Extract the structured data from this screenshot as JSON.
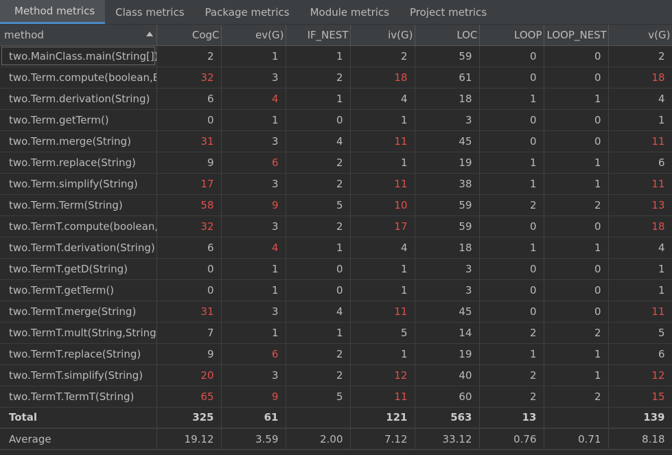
{
  "tabs": [
    {
      "label": "Method metrics",
      "active": true
    },
    {
      "label": "Class metrics",
      "active": false
    },
    {
      "label": "Package metrics",
      "active": false
    },
    {
      "label": "Module metrics",
      "active": false
    },
    {
      "label": "Project metrics",
      "active": false
    }
  ],
  "columns": [
    "method",
    "CogC",
    "ev(G)",
    "IF_NEST",
    "iv(G)",
    "LOC",
    "LOOP",
    "LOOP_NEST",
    "v(G)"
  ],
  "sort_column": "method",
  "sort_direction": "ascending",
  "highlight_color": "#e0504a",
  "rows": [
    {
      "cells": [
        "two.MainClass.main(String[])",
        "2",
        "1",
        "1",
        "2",
        "59",
        "0",
        "0",
        "2"
      ],
      "flags": [
        0,
        0,
        0,
        0,
        0,
        0,
        0,
        0,
        0
      ]
    },
    {
      "cells": [
        "two.Term.compute(boolean,BigInteger)",
        "32",
        "3",
        "2",
        "18",
        "61",
        "0",
        "0",
        "18"
      ],
      "flags": [
        0,
        1,
        0,
        0,
        1,
        0,
        0,
        0,
        1
      ]
    },
    {
      "cells": [
        "two.Term.derivation(String)",
        "6",
        "4",
        "1",
        "4",
        "18",
        "1",
        "1",
        "4"
      ],
      "flags": [
        0,
        0,
        1,
        0,
        0,
        0,
        0,
        0,
        0
      ]
    },
    {
      "cells": [
        "two.Term.getTerm()",
        "0",
        "1",
        "0",
        "1",
        "3",
        "0",
        "0",
        "1"
      ],
      "flags": [
        0,
        0,
        0,
        0,
        0,
        0,
        0,
        0,
        0
      ]
    },
    {
      "cells": [
        "two.Term.merge(String)",
        "31",
        "3",
        "4",
        "11",
        "45",
        "0",
        "0",
        "11"
      ],
      "flags": [
        0,
        1,
        0,
        0,
        1,
        0,
        0,
        0,
        1
      ]
    },
    {
      "cells": [
        "two.Term.replace(String)",
        "9",
        "6",
        "2",
        "1",
        "19",
        "1",
        "1",
        "6"
      ],
      "flags": [
        0,
        0,
        1,
        0,
        0,
        0,
        0,
        0,
        0
      ]
    },
    {
      "cells": [
        "two.Term.simplify(String)",
        "17",
        "3",
        "2",
        "11",
        "38",
        "1",
        "1",
        "11"
      ],
      "flags": [
        0,
        1,
        0,
        0,
        1,
        0,
        0,
        0,
        1
      ]
    },
    {
      "cells": [
        "two.Term.Term(String)",
        "58",
        "9",
        "5",
        "10",
        "59",
        "2",
        "2",
        "13"
      ],
      "flags": [
        0,
        1,
        1,
        0,
        1,
        0,
        0,
        0,
        1
      ]
    },
    {
      "cells": [
        "two.TermT.compute(boolean,BigInteger)",
        "32",
        "3",
        "2",
        "17",
        "59",
        "0",
        "0",
        "18"
      ],
      "flags": [
        0,
        1,
        0,
        0,
        1,
        0,
        0,
        0,
        1
      ]
    },
    {
      "cells": [
        "two.TermT.derivation(String)",
        "6",
        "4",
        "1",
        "4",
        "18",
        "1",
        "1",
        "4"
      ],
      "flags": [
        0,
        0,
        1,
        0,
        0,
        0,
        0,
        0,
        0
      ]
    },
    {
      "cells": [
        "two.TermT.getD(String)",
        "0",
        "1",
        "0",
        "1",
        "3",
        "0",
        "0",
        "1"
      ],
      "flags": [
        0,
        0,
        0,
        0,
        0,
        0,
        0,
        0,
        0
      ]
    },
    {
      "cells": [
        "two.TermT.getTerm()",
        "0",
        "1",
        "0",
        "1",
        "3",
        "0",
        "0",
        "1"
      ],
      "flags": [
        0,
        0,
        0,
        0,
        0,
        0,
        0,
        0,
        0
      ]
    },
    {
      "cells": [
        "two.TermT.merge(String)",
        "31",
        "3",
        "4",
        "11",
        "45",
        "0",
        "0",
        "11"
      ],
      "flags": [
        0,
        1,
        0,
        0,
        1,
        0,
        0,
        0,
        1
      ]
    },
    {
      "cells": [
        "two.TermT.mult(String,String)",
        "7",
        "1",
        "1",
        "5",
        "14",
        "2",
        "2",
        "5"
      ],
      "flags": [
        0,
        0,
        0,
        0,
        0,
        0,
        0,
        0,
        0
      ]
    },
    {
      "cells": [
        "two.TermT.replace(String)",
        "9",
        "6",
        "2",
        "1",
        "19",
        "1",
        "1",
        "6"
      ],
      "flags": [
        0,
        0,
        1,
        0,
        0,
        0,
        0,
        0,
        0
      ]
    },
    {
      "cells": [
        "two.TermT.simplify(String)",
        "20",
        "3",
        "2",
        "12",
        "40",
        "2",
        "1",
        "12"
      ],
      "flags": [
        0,
        1,
        0,
        0,
        1,
        0,
        0,
        0,
        1
      ]
    },
    {
      "cells": [
        "two.TermT.TermT(String)",
        "65",
        "9",
        "5",
        "11",
        "60",
        "2",
        "2",
        "15"
      ],
      "flags": [
        0,
        1,
        1,
        0,
        1,
        0,
        0,
        0,
        1
      ]
    }
  ],
  "total": [
    "Total",
    "325",
    "61",
    "",
    "121",
    "563",
    "13",
    "",
    "139"
  ],
  "average": [
    "Average",
    "19.12",
    "3.59",
    "2.00",
    "7.12",
    "33.12",
    "0.76",
    "0.71",
    "8.18"
  ]
}
